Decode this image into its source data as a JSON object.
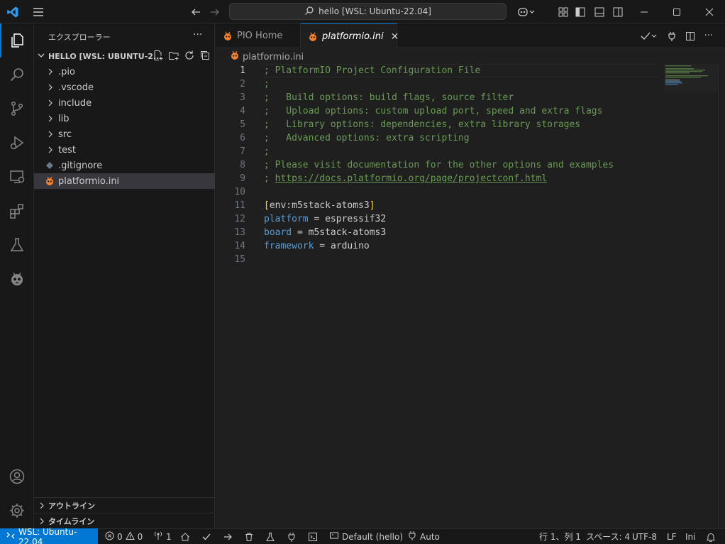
{
  "window": {
    "command_center": "hello [WSL: Ubuntu-22.04]"
  },
  "sidebar": {
    "title": "エクスプローラー",
    "more": "···",
    "folder": "HELLO [WSL: UBUNTU-2...",
    "items": [
      {
        "label": ".pio",
        "type": "folder"
      },
      {
        "label": ".vscode",
        "type": "folder"
      },
      {
        "label": "include",
        "type": "folder"
      },
      {
        "label": "lib",
        "type": "folder"
      },
      {
        "label": "src",
        "type": "folder"
      },
      {
        "label": "test",
        "type": "folder"
      },
      {
        "label": ".gitignore",
        "type": "file"
      },
      {
        "label": "platformio.ini",
        "type": "file",
        "selected": true
      }
    ],
    "outline": "アウトライン",
    "timeline": "タイムライン"
  },
  "tabs": [
    {
      "label": "PIO Home",
      "active": false
    },
    {
      "label": "platformio.ini",
      "active": true,
      "close": "✕"
    }
  ],
  "breadcrumb": "platformio.ini",
  "code": {
    "line_numbers": [
      "1",
      "2",
      "3",
      "4",
      "5",
      "6",
      "7",
      "8",
      "9",
      "10",
      "11",
      "12",
      "13",
      "14",
      "15"
    ],
    "l1": "; PlatformIO Project Configuration File",
    "l2": ";",
    "l3": ";   Build options: build flags, source filter",
    "l4": ";   Upload options: custom upload port, speed and extra flags",
    "l5": ";   Library options: dependencies, extra library storages",
    "l6": ";   Advanced options: extra scripting",
    "l7": ";",
    "l8": "; Please visit documentation for the other options and examples",
    "l9_prefix": "; ",
    "l9_link": "https://docs.platformio.org/page/projectconf.html",
    "l11_open": "[",
    "l11_name": "env:m5stack-atoms3",
    "l11_close": "]",
    "l12_key": "platform",
    "l12_eq": " = ",
    "l12_val": "espressif32",
    "l13_key": "board",
    "l13_eq": " = ",
    "l13_val": "m5stack-atoms3",
    "l14_key": "framework",
    "l14_eq": " = ",
    "l14_val": "arduino"
  },
  "statusbar": {
    "remote": "WSL: Ubuntu-22.04",
    "errors": "0",
    "warnings": "0",
    "ports": "1",
    "env": "Default (hello)",
    "auto": "Auto",
    "position": "行 1、列 1",
    "spaces": "スペース: 4",
    "encoding": "UTF-8",
    "eol": "LF",
    "language": "Ini"
  },
  "colors": {
    "accent": "#0078d4",
    "comment": "#6a9955",
    "key": "#569cd6",
    "platformio_orange": "#f5822a"
  }
}
